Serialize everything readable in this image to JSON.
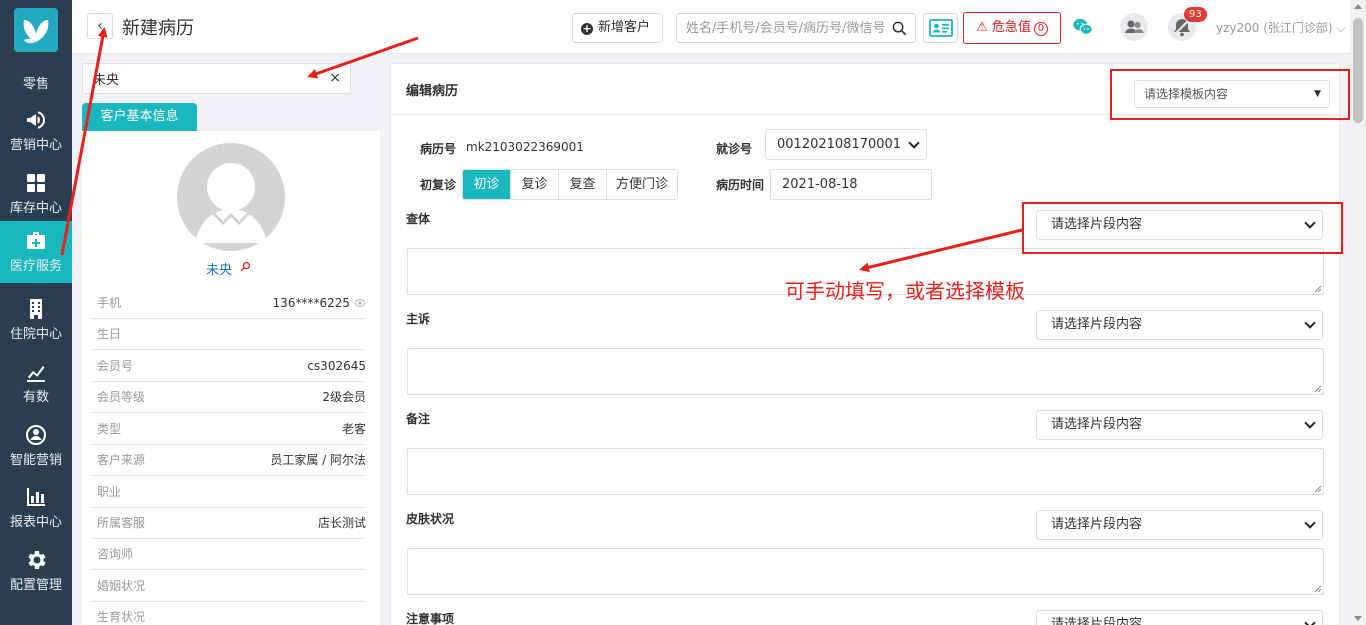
{
  "sidebar": {
    "items": [
      {
        "label": "零售",
        "icon": "retail-icon"
      },
      {
        "label": "营销中心",
        "icon": "megaphone-icon"
      },
      {
        "label": "库存中心",
        "icon": "grid-icon"
      },
      {
        "label": "医疗服务",
        "icon": "medical-kit-icon",
        "active": true
      },
      {
        "label": "住院中心",
        "icon": "hospital-icon"
      },
      {
        "label": "有数",
        "icon": "trend-chart-icon"
      },
      {
        "label": "智能营销",
        "icon": "smart-marketing-icon"
      },
      {
        "label": "报表中心",
        "icon": "bar-chart-icon"
      },
      {
        "label": "配置管理",
        "icon": "gear-icon"
      }
    ]
  },
  "header": {
    "back_label": "‹",
    "title": "新建病历",
    "add_customer_label": "新增客户",
    "search_placeholder": "姓名/手机号/会员号/病历号/微信号",
    "danger_label": "危急值",
    "danger_count": "0",
    "notify_badge": "93",
    "user_label": "yzy200 (张江门诊部) ⌵"
  },
  "customer": {
    "search_value": "未央",
    "clear_label": "×",
    "tab_label": "客户基本信息",
    "name": "未央",
    "fields": [
      {
        "key": "手机",
        "value": "136****6225"
      },
      {
        "key": "生日",
        "value": ""
      },
      {
        "key": "会员号",
        "value": "cs302645"
      },
      {
        "key": "会员等级",
        "value": "2级会员"
      },
      {
        "key": "类型",
        "value": "老客"
      },
      {
        "key": "客户来源",
        "value": "员工家属 / 阿尔法"
      },
      {
        "key": "职业",
        "value": ""
      },
      {
        "key": "所属客服",
        "value": "店长测试"
      },
      {
        "key": "咨询师",
        "value": ""
      },
      {
        "key": "婚姻状况",
        "value": ""
      },
      {
        "key": "生育状况",
        "value": ""
      }
    ]
  },
  "record": {
    "title": "编辑病历",
    "template_placeholder": "请选择模板内容",
    "caret": "▼",
    "record_no_label": "病历号",
    "record_no": "mk2103022369001",
    "visit_no_label": "就诊号",
    "visit_no": "001202108170001",
    "visit_type_label": "初复诊",
    "visit_types": [
      "初诊",
      "复诊",
      "复查",
      "方便门诊"
    ],
    "visit_type_selected": "初诊",
    "record_time_label": "病历时间",
    "record_time": "2021-08-18",
    "segment_placeholder": "请选择片段内容",
    "sections": [
      "查体",
      "主诉",
      "备注",
      "皮肤状况",
      "注意事项"
    ]
  },
  "annotation": {
    "text": "可手动填写，或者选择模板"
  },
  "colors": {
    "sidebar_bg": "#2a3e4f",
    "accent": "#1bb7bf",
    "danger": "#e02020",
    "annotation": "#e8201c"
  }
}
